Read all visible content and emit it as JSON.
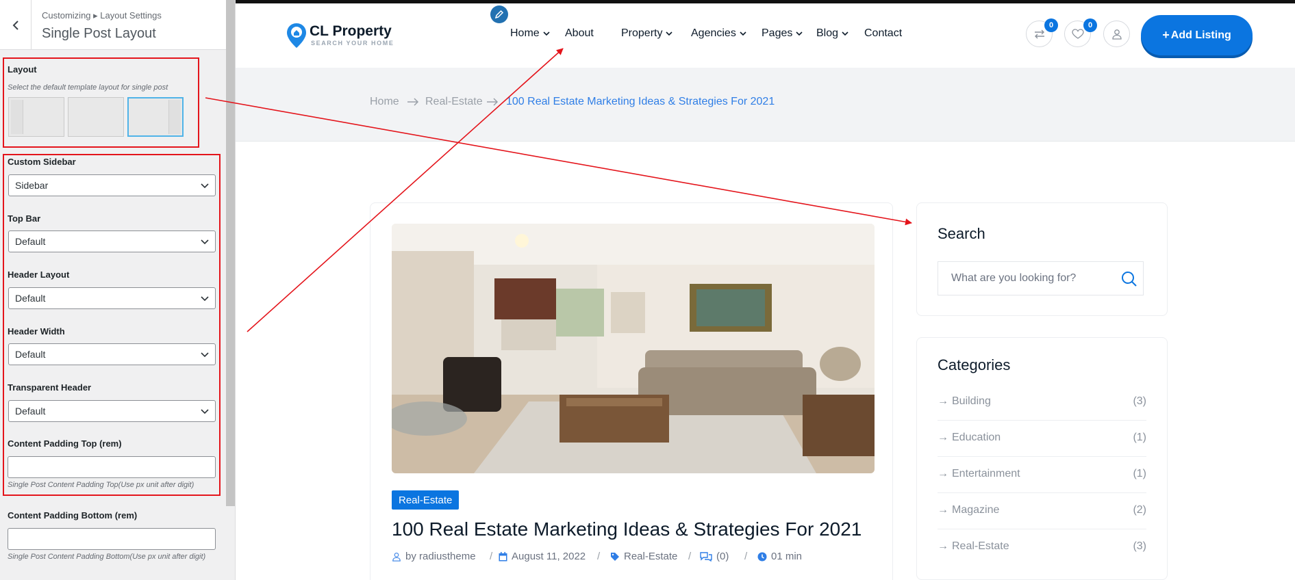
{
  "customizer": {
    "breadcrumb": "Customizing ▸ Layout Settings",
    "title": "Single Post Layout",
    "layout": {
      "label": "Layout",
      "description": "Select the default template layout for single post",
      "options": [
        "left-sidebar",
        "full-width",
        "right-sidebar"
      ],
      "selected": "right-sidebar"
    },
    "custom_sidebar": {
      "label": "Custom Sidebar",
      "value": "Sidebar"
    },
    "top_bar": {
      "label": "Top Bar",
      "value": "Default"
    },
    "header_layout": {
      "label": "Header Layout",
      "value": "Default"
    },
    "header_width": {
      "label": "Header Width",
      "value": "Default"
    },
    "transparent_header": {
      "label": "Transparent Header",
      "value": "Default"
    },
    "padding_top": {
      "label": "Content Padding Top (rem)",
      "value": "",
      "description": "Single Post Content Padding Top(Use px unit after digit)"
    },
    "padding_bottom": {
      "label": "Content Padding Bottom (rem)",
      "value": "",
      "description": "Single Post Content Padding Bottom(Use px unit after digit)"
    },
    "annotation_color": "#e4141b"
  },
  "site": {
    "logo": {
      "name": "CL Property",
      "tagline": "SEARCH YOUR HOME"
    },
    "nav": [
      {
        "label": "Home",
        "dropdown": true
      },
      {
        "label": "About",
        "dropdown": false
      },
      {
        "label": "Property",
        "dropdown": true
      },
      {
        "label": "Agencies",
        "dropdown": true
      },
      {
        "label": "Pages",
        "dropdown": true
      },
      {
        "label": "Blog",
        "dropdown": true
      },
      {
        "label": "Contact",
        "dropdown": false
      }
    ],
    "compare_count": "0",
    "wishlist_count": "0",
    "add_listing": "Add Listing",
    "breadcrumb": [
      "Home",
      "Real-Estate",
      "100 Real Estate Marketing Ideas & Strategies For 2021"
    ],
    "post": {
      "category_tag": "Real-Estate",
      "title": "100 Real Estate Marketing Ideas & Strategies For 2021",
      "author": "by radiustheme",
      "date": "August 11, 2022",
      "category": "Real-Estate",
      "comments": "(0)",
      "read_time": "01 min"
    },
    "search_widget": {
      "title": "Search",
      "placeholder": "What are you looking for?"
    },
    "categories_widget": {
      "title": "Categories",
      "items": [
        {
          "name": "Building",
          "count": "(3)"
        },
        {
          "name": "Education",
          "count": "(1)"
        },
        {
          "name": "Entertainment",
          "count": "(1)"
        },
        {
          "name": "Magazine",
          "count": "(2)"
        },
        {
          "name": "Real-Estate",
          "count": "(3)"
        }
      ]
    },
    "accent_color": "#0b75e0"
  }
}
